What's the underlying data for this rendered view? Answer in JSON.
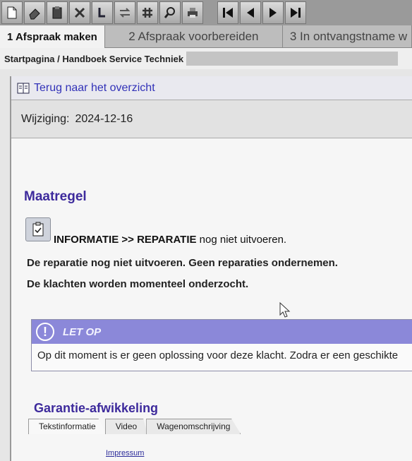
{
  "toolbar": {
    "buttons": [
      {
        "name": "new-document-icon"
      },
      {
        "name": "eraser-icon"
      },
      {
        "name": "clipboard-icon"
      },
      {
        "name": "tools-icon"
      },
      {
        "name": "text-cursor-icon"
      },
      {
        "name": "swap-icon"
      },
      {
        "name": "hash-icon"
      },
      {
        "name": "search-icon"
      },
      {
        "name": "print-icon"
      },
      {
        "name": "first-page-icon"
      },
      {
        "name": "previous-page-icon"
      },
      {
        "name": "next-page-icon"
      },
      {
        "name": "last-page-icon"
      }
    ]
  },
  "tabs": [
    {
      "label": "1 Afspraak maken"
    },
    {
      "label": "2 Afspraak voorbereiden"
    },
    {
      "label": "3 In ontvangstname w"
    }
  ],
  "breadcrumb": "Startpagina / Handboek Service Techniek",
  "back_link": "Terug naar het overzicht",
  "change": {
    "label": "Wijziging:",
    "value": "2024-12-16"
  },
  "section_title": "Maatregel",
  "info": {
    "bold": "INFORMATIE >> REPARATIE",
    "rest": " nog niet uitvoeren."
  },
  "body_lines": [
    "De reparatie nog niet uitvoeren. Geen reparaties ondernemen.",
    "De klachten worden momenteel onderzocht."
  ],
  "notice": {
    "icon": "!",
    "title": "LET OP",
    "text": "Op dit moment is er geen oplossing voor deze klacht. Zodra er een geschikte"
  },
  "warranty_title": "Garantie-afwikkeling",
  "subtabs": [
    {
      "label": "Tekstinformatie"
    },
    {
      "label": "Video"
    },
    {
      "label": "Wagenomschrijving"
    }
  ],
  "footer_link": "Impressum"
}
